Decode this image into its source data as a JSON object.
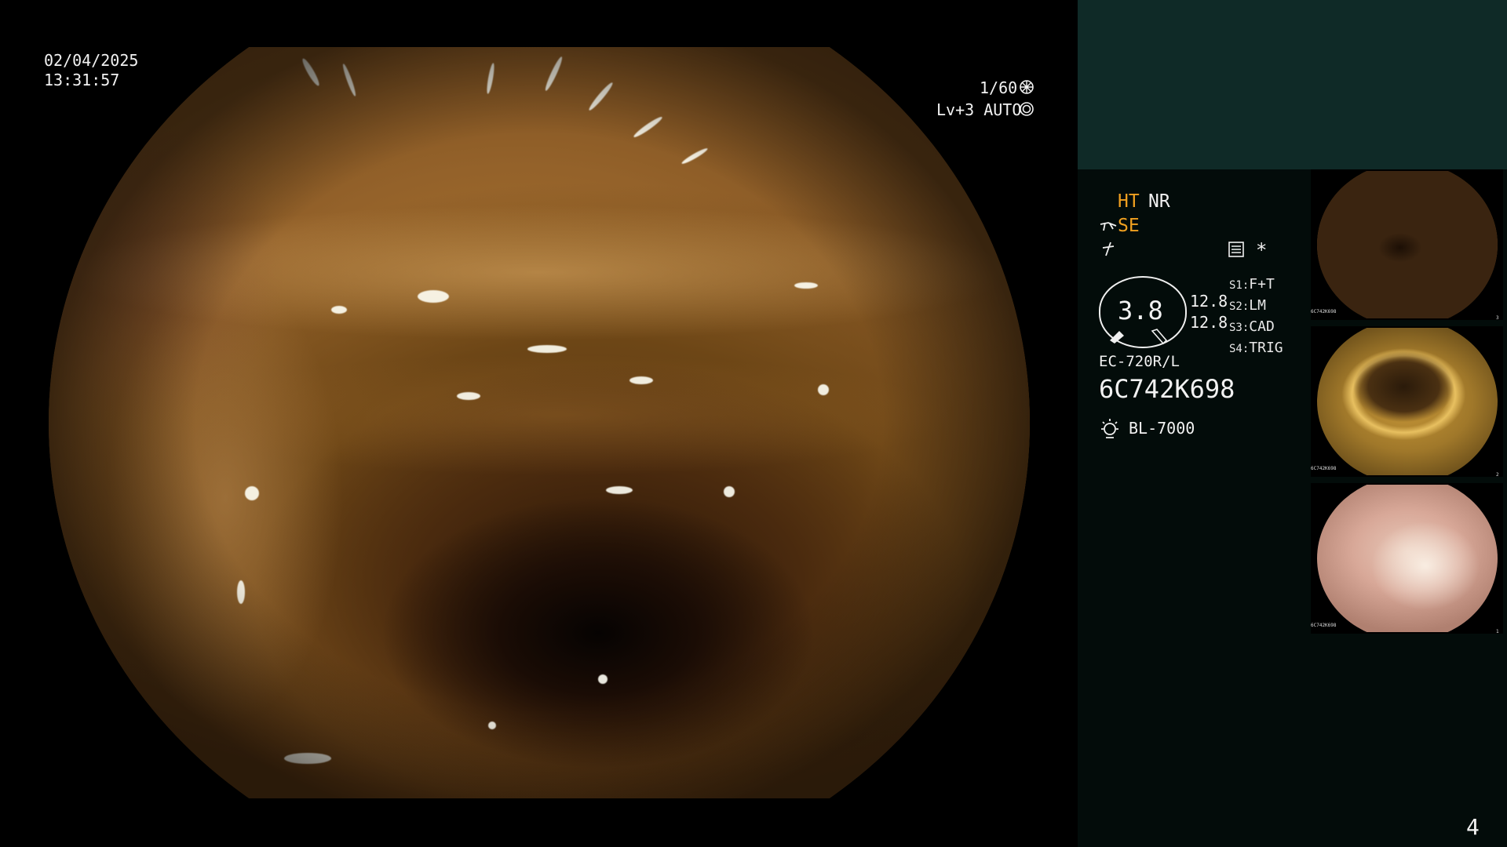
{
  "overlay": {
    "date": "02/04/2025",
    "time": "13:31:57",
    "shutter": "1/60",
    "iris_mode": "Lv+3 AUTO"
  },
  "settings": {
    "ht": "HT",
    "nr": "NR",
    "se": "SE",
    "zoom_value": "3.8",
    "values": [
      "12.8",
      "12.8"
    ],
    "switches": [
      {
        "key": "S1",
        "value": "F+T"
      },
      {
        "key": "S2",
        "value": "LM"
      },
      {
        "key": "S3",
        "value": "CAD"
      },
      {
        "key": "S4",
        "value": "TRIG"
      }
    ],
    "asterisk": "*",
    "scope_model": "EC-720R/L",
    "serial": "6C742K698",
    "light_source": "BL-7000"
  },
  "thumbnails": [
    {
      "serial": "6C742K698",
      "index": "3"
    },
    {
      "serial": "6C742K698",
      "index": "2"
    },
    {
      "serial": "6C742K698",
      "index": "1"
    }
  ],
  "page_number": "4",
  "colors": {
    "panel_top": "#0f2a27",
    "panel_bg": "#030c0a",
    "accent_orange": "#f0a020"
  }
}
